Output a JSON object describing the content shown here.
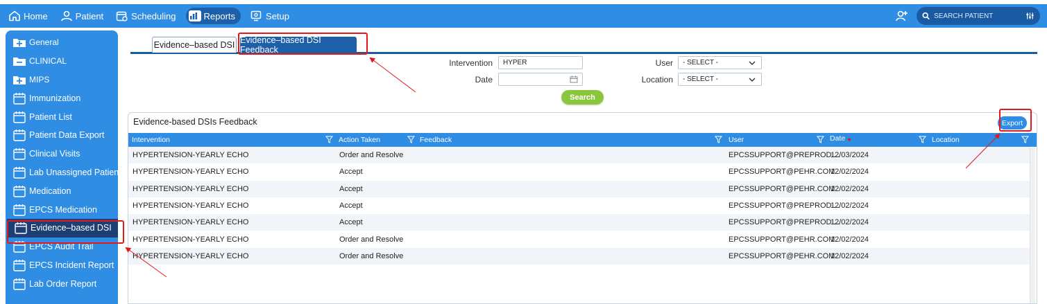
{
  "topnav": {
    "items": [
      {
        "label": "Home",
        "icon": "home-icon"
      },
      {
        "label": "Patient",
        "icon": "person-icon"
      },
      {
        "label": "Scheduling",
        "icon": "calendar-icon"
      },
      {
        "label": "Reports",
        "icon": "chart-icon"
      },
      {
        "label": "Setup",
        "icon": "setup-icon"
      }
    ],
    "search_placeholder": "SEARCH PATIENT"
  },
  "sidebar": {
    "items": [
      {
        "label": "General"
      },
      {
        "label": "CLINICAL"
      },
      {
        "label": "MIPS"
      },
      {
        "label": "Immunization"
      },
      {
        "label": "Patient List"
      },
      {
        "label": "Patient Data Export"
      },
      {
        "label": "Clinical Visits"
      },
      {
        "label": "Lab Unassigned Patient"
      },
      {
        "label": "Medication"
      },
      {
        "label": "EPCS Medication"
      },
      {
        "label": "Evidence–based DSI"
      },
      {
        "label": "EPCS Audit Trail"
      },
      {
        "label": "EPCS Incident Report"
      },
      {
        "label": "Lab Order Report"
      }
    ]
  },
  "tabs": [
    {
      "label": "Evidence–based DSI"
    },
    {
      "label": "Evidence–based DSI Feedback"
    }
  ],
  "filters": {
    "intervention_label": "Intervention",
    "intervention_value": "HYPER",
    "date_label": "Date",
    "date_value": "",
    "user_label": "User",
    "user_value": "- SELECT -",
    "location_label": "Location",
    "location_value": "- SELECT -",
    "search_button": "Search"
  },
  "grid": {
    "title": "Evidence-based DSIs Feedback",
    "export_button": "Export",
    "columns": [
      "Intervention",
      "Action Taken",
      "Feedback",
      "User",
      "Date",
      "Location"
    ],
    "rows": [
      {
        "intervention": "HYPERTENSION-YEARLY ECHO",
        "action": "Order and Resolve",
        "feedback": "",
        "user": "EPCSSUPPORT@PREPROD....",
        "date": "12/03/2024",
        "location": ""
      },
      {
        "intervention": "HYPERTENSION-YEARLY ECHO",
        "action": "Accept",
        "feedback": "",
        "user": "EPCSSUPPORT@PEHR.COM",
        "date": "12/02/2024",
        "location": ""
      },
      {
        "intervention": "HYPERTENSION-YEARLY ECHO",
        "action": "Accept",
        "feedback": "",
        "user": "EPCSSUPPORT@PEHR.COM",
        "date": "12/02/2024",
        "location": ""
      },
      {
        "intervention": "HYPERTENSION-YEARLY ECHO",
        "action": "Accept",
        "feedback": "",
        "user": "EPCSSUPPORT@PREPROD....",
        "date": "12/02/2024",
        "location": ""
      },
      {
        "intervention": "HYPERTENSION-YEARLY ECHO",
        "action": "Accept",
        "feedback": "",
        "user": "EPCSSUPPORT@PREPROD....",
        "date": "12/02/2024",
        "location": ""
      },
      {
        "intervention": "HYPERTENSION-YEARLY ECHO",
        "action": "Order and Resolve",
        "feedback": "",
        "user": "EPCSSUPPORT@PEHR.COM",
        "date": "12/02/2024",
        "location": ""
      },
      {
        "intervention": "HYPERTENSION-YEARLY ECHO",
        "action": "Order and Resolve",
        "feedback": "",
        "user": "EPCSSUPPORT@PEHR.COM",
        "date": "12/02/2024",
        "location": ""
      }
    ]
  },
  "colors": {
    "primary": "#2f8de4",
    "dark": "#1d5fa8",
    "sidebar_active": "#1d3f73",
    "search_button": "#8cc63f",
    "annotation": "#e0191c"
  }
}
